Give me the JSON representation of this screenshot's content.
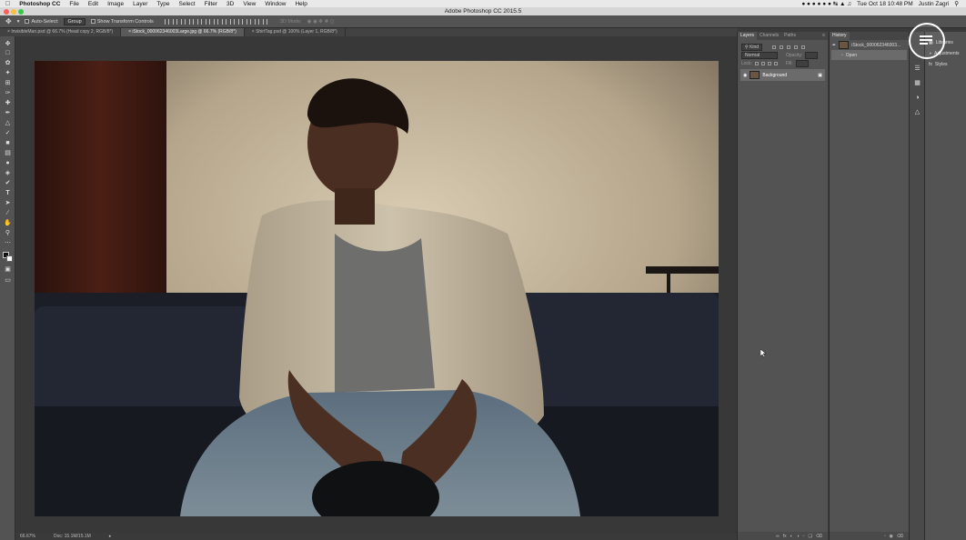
{
  "menubar": {
    "app": "Photoshop CC",
    "items": [
      "File",
      "Edit",
      "Image",
      "Layer",
      "Type",
      "Select",
      "Filter",
      "3D",
      "View",
      "Window",
      "Help"
    ],
    "clock": "Tue Oct 18  10:48 PM",
    "user": "Justin Zagri"
  },
  "window": {
    "title": "Adobe Photoshop CC 2015.5"
  },
  "options": {
    "auto_select": "Auto-Select:",
    "group": "Group",
    "transform": "Show Transform Controls",
    "mode3d": "3D Mode:"
  },
  "tabs": [
    {
      "label": "InvisibleMan.psd @ 66.7% (Head copy 2, RGB/8*)"
    },
    {
      "label": "iStock_000062346003Large.jpg @ 66.7% (RGB/8*)"
    },
    {
      "label": "ShirtTag.psd @ 100% (Layer 1, RGB/8*)"
    }
  ],
  "status": {
    "zoom": "66.67%",
    "doc": "Doc: 15.1M/15.1M"
  },
  "layers": {
    "tabs": [
      "Layers",
      "Channels",
      "Paths"
    ],
    "kind": "Kind",
    "blend": "Normal",
    "opacity": "Opacity:",
    "lock": "Lock:",
    "fill": "Fill:",
    "layer_name": "Background"
  },
  "history": {
    "tab": "History",
    "snapshot": "iStock_000062346003...",
    "step": "Open"
  },
  "libraries": {
    "items": [
      "Libraries",
      "Adjustments",
      "Styles"
    ]
  },
  "colors": {
    "accent": "#6b6b6b"
  }
}
